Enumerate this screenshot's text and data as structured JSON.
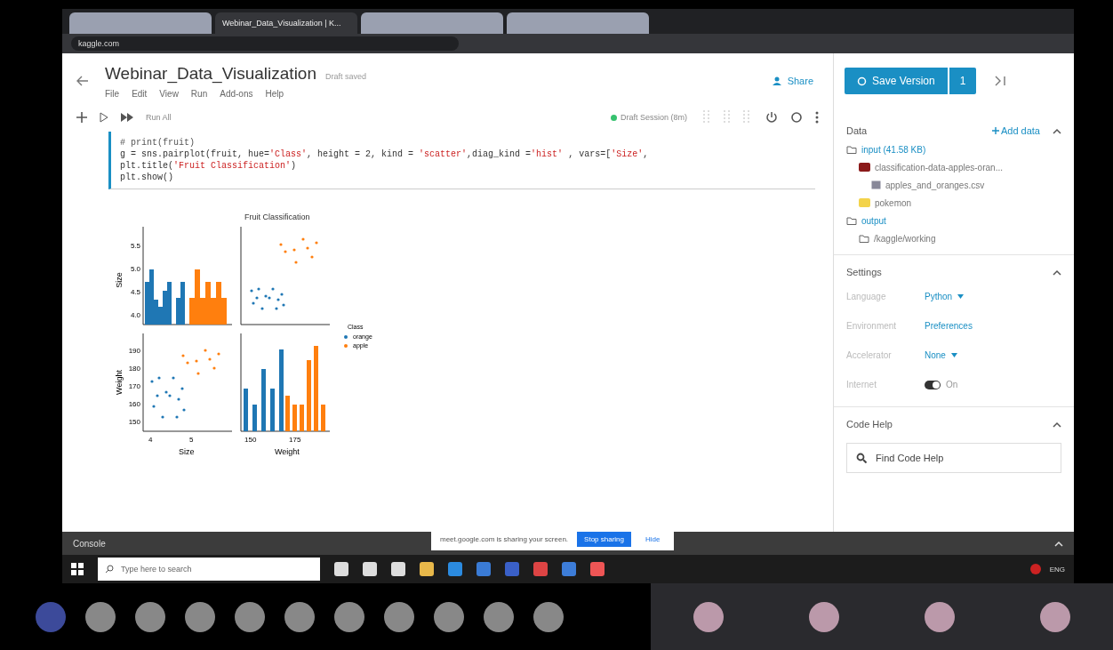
{
  "browser": {
    "tabs": [
      {
        "selected": false
      },
      {
        "title": "Webinar_Data_Visualization | K...",
        "selected": true
      },
      {
        "selected": false
      },
      {
        "selected": false
      }
    ],
    "address": "kaggle.com"
  },
  "notebook": {
    "title": "Webinar_Data_Visualization",
    "save_status": "Draft saved",
    "menu": [
      "File",
      "Edit",
      "View",
      "Run",
      "Add-ons",
      "Help"
    ],
    "share": "Share",
    "save_version": "Save Version",
    "save_count": "1"
  },
  "toolbar": {
    "run_all": "Run All",
    "session": "Draft Session (8m)"
  },
  "code_lines": [
    [
      {
        "kind": "comment",
        "text": "# print(fruit)"
      }
    ],
    [
      {
        "kind": "code",
        "text": "g = sns.pairplot(fruit, hue="
      },
      {
        "kind": "string",
        "text": "'Class'"
      },
      {
        "kind": "code",
        "text": ", height = 2, kind = "
      },
      {
        "kind": "string",
        "text": "'scatter'"
      },
      {
        "kind": "code",
        "text": ",diag_kind ="
      },
      {
        "kind": "string",
        "text": "'hist'"
      },
      {
        "kind": "code",
        "text": " , vars=["
      },
      {
        "kind": "string",
        "text": "'Size'"
      },
      {
        "kind": "code",
        "text": ","
      }
    ],
    [
      {
        "kind": "code",
        "text": "plt.title("
      },
      {
        "kind": "string",
        "text": "'Fruit Classification'"
      },
      {
        "kind": "code",
        "text": ")"
      }
    ],
    [
      {
        "kind": "code",
        "text": "plt.show()"
      }
    ]
  ],
  "plot": {
    "title": "Fruit Classification",
    "size_ylabel": "Size",
    "weight_ylabel": "Weight",
    "size_xlabel": "Size",
    "weight_xlabel": "Weight",
    "size_ticks": [
      "5.5",
      "5.0",
      "4.5",
      "4.0"
    ],
    "weight_ticks": [
      "190",
      "180",
      "170",
      "160",
      "150"
    ],
    "size_xticks": [
      "4",
      "5"
    ],
    "weight_xticks": [
      "150",
      "175"
    ],
    "legend_title": "Class",
    "legend": [
      {
        "label": "orange",
        "color": "#1f77b4"
      },
      {
        "label": "apple",
        "color": "#ff7f0e"
      }
    ]
  },
  "data_panel": {
    "title": "Data",
    "add": "Add data",
    "tree": [
      {
        "label": "input (41.58 KB)",
        "kind": "folder",
        "children": [
          {
            "label": "classification-data-apples-oran...",
            "kind": "dataset",
            "color": "#8b1a1a",
            "children": [
              {
                "label": "apples_and_oranges.csv",
                "kind": "file"
              }
            ]
          },
          {
            "label": "pokemon",
            "kind": "dataset",
            "color": "#f3d34a"
          }
        ]
      },
      {
        "label": "output",
        "kind": "folder",
        "children": [
          {
            "label": "/kaggle/working",
            "kind": "folder"
          }
        ]
      }
    ]
  },
  "settings": {
    "title": "Settings",
    "rows": [
      {
        "label": "Language",
        "value": "Python",
        "kind": "dropdown"
      },
      {
        "label": "Environment",
        "value": "Preferences",
        "kind": "link"
      },
      {
        "label": "Accelerator",
        "value": "None",
        "kind": "dropdown"
      },
      {
        "label": "Internet",
        "value": "On",
        "kind": "toggle",
        "on": true
      }
    ]
  },
  "code_help": {
    "title": "Code Help",
    "search": "Find Code Help"
  },
  "console": {
    "label": "Console",
    "notice": "meet.google.com is sharing your screen.",
    "stop": "Stop sharing",
    "hide": "Hide"
  },
  "taskbar": {
    "search_placeholder": "Type here to search",
    "tray_lang": "ENG"
  }
}
